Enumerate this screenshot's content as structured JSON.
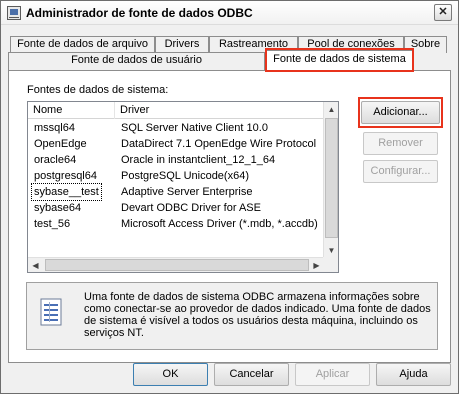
{
  "window": {
    "title": "Administrador de fonte de dados ODBC"
  },
  "tabs": {
    "row1": [
      "Fonte de dados de arquivo",
      "Drivers",
      "Rastreamento",
      "Pool de conexões",
      "Sobre"
    ],
    "row2": [
      "Fonte de dados de usuário",
      "Fonte de dados de sistema"
    ],
    "active": "Fonte de dados de sistema"
  },
  "panel": {
    "section_label": "Fontes de dados de sistema:",
    "columns": [
      "Nome",
      "Driver"
    ],
    "rows": [
      {
        "name": "mssql64",
        "driver": "SQL Server Native Client 10.0"
      },
      {
        "name": "OpenEdge",
        "driver": "DataDirect 7.1 OpenEdge Wire Protocol"
      },
      {
        "name": "oracle64",
        "driver": "Oracle in instantclient_12_1_64"
      },
      {
        "name": "postgresql64",
        "driver": "PostgreSQL Unicode(x64)"
      },
      {
        "name": "sybase__test",
        "driver": "Adaptive Server Enterprise"
      },
      {
        "name": "sybase64",
        "driver": "Devart ODBC Driver for ASE"
      },
      {
        "name": "test_56",
        "driver": "Microsoft Access Driver (*.mdb, *.accdb)"
      }
    ],
    "buttons": {
      "add": "Adicionar...",
      "remove": "Remover",
      "configure": "Configurar..."
    },
    "info_text": "Uma fonte de dados de sistema ODBC armazena informações sobre como conectar-se ao provedor de dados indicado. Uma fonte de dados de sistema é visível a todos os usuários desta máquina, incluindo os serviços NT."
  },
  "footer": {
    "ok": "OK",
    "cancel": "Cancelar",
    "apply": "Aplicar",
    "help": "Ajuda"
  },
  "colors": {
    "highlight": "#e8331c",
    "window_bg": "#f0f0f0"
  },
  "icons": [
    "app-icon",
    "close-icon",
    "database-info-icon"
  ]
}
